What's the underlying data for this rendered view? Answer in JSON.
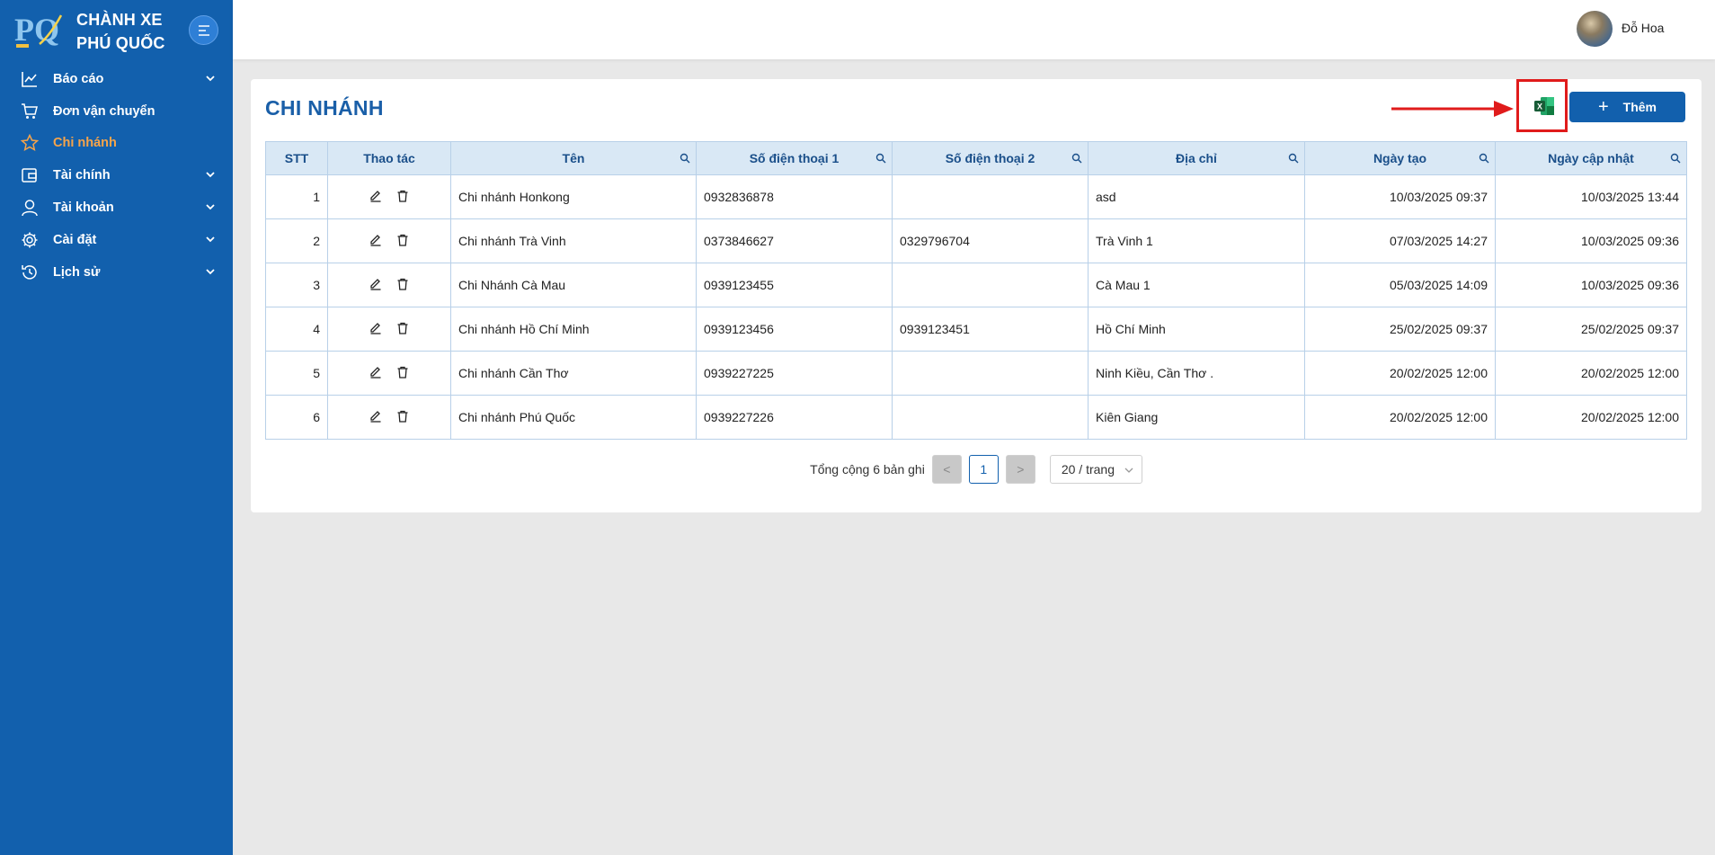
{
  "brand": {
    "line1": "CHÀNH XE",
    "line2": "PHÚ QUỐC",
    "logo_text": "PQ"
  },
  "sidebar": {
    "items": [
      {
        "label": "Báo cáo",
        "icon": "chart-line-icon",
        "has_submenu": true,
        "active": false
      },
      {
        "label": "Đơn vận chuyển",
        "icon": "cart-icon",
        "has_submenu": false,
        "active": false
      },
      {
        "label": "Chi nhánh",
        "icon": "star-icon",
        "has_submenu": false,
        "active": true
      },
      {
        "label": "Tài chính",
        "icon": "wallet-icon",
        "has_submenu": true,
        "active": false
      },
      {
        "label": "Tài khoản",
        "icon": "user-icon",
        "has_submenu": true,
        "active": false
      },
      {
        "label": "Cài đặt",
        "icon": "gear-icon",
        "has_submenu": true,
        "active": false
      },
      {
        "label": "Lịch sử",
        "icon": "history-icon",
        "has_submenu": true,
        "active": false
      }
    ]
  },
  "header": {
    "user_name": "Đỗ Hoa"
  },
  "page": {
    "title": "CHI NHÁNH",
    "add_label": "Thêm"
  },
  "colors": {
    "primary": "#1260ad",
    "active_menu": "#f7a44a",
    "highlight": "#e01b1b",
    "header_bg": "#d9e8f5"
  },
  "table": {
    "columns": [
      "STT",
      "Thao tác",
      "Tên",
      "Số điện thoại 1",
      "Số điện thoại 2",
      "Địa chỉ",
      "Ngày tạo",
      "Ngày cập nhật"
    ],
    "rows": [
      {
        "stt": "1",
        "ten": "Chi nhánh Honkong",
        "sdt1": "0932836878",
        "sdt2": "",
        "diachi": "asd",
        "ngaytao": "10/03/2025 09:37",
        "ngaycapnhat": "10/03/2025 13:44"
      },
      {
        "stt": "2",
        "ten": "Chi nhánh Trà Vinh",
        "sdt1": "0373846627",
        "sdt2": "0329796704",
        "diachi": "Trà Vinh 1",
        "ngaytao": "07/03/2025 14:27",
        "ngaycapnhat": "10/03/2025 09:36"
      },
      {
        "stt": "3",
        "ten": "Chi Nhánh Cà Mau",
        "sdt1": "0939123455",
        "sdt2": "",
        "diachi": "Cà Mau 1",
        "ngaytao": "05/03/2025 14:09",
        "ngaycapnhat": "10/03/2025 09:36"
      },
      {
        "stt": "4",
        "ten": "Chi nhánh Hồ Chí Minh",
        "sdt1": "0939123456",
        "sdt2": "0939123451",
        "diachi": "Hồ Chí Minh",
        "ngaytao": "25/02/2025 09:37",
        "ngaycapnhat": "25/02/2025 09:37"
      },
      {
        "stt": "5",
        "ten": "Chi nhánh Cần Thơ",
        "sdt1": "0939227225",
        "sdt2": "",
        "diachi": "Ninh Kiều, Cần Thơ .",
        "ngaytao": "20/02/2025 12:00",
        "ngaycapnhat": "20/02/2025 12:00"
      },
      {
        "stt": "6",
        "ten": "Chi nhánh Phú Quốc",
        "sdt1": "0939227226",
        "sdt2": "",
        "diachi": "Kiên Giang",
        "ngaytao": "20/02/2025 12:00",
        "ngaycapnhat": "20/02/2025 12:00"
      }
    ]
  },
  "pagination": {
    "total_text": "Tổng cộng 6 bản ghi",
    "current_page": "1",
    "page_size": "20 / trang",
    "prev": "<",
    "next": ">"
  }
}
